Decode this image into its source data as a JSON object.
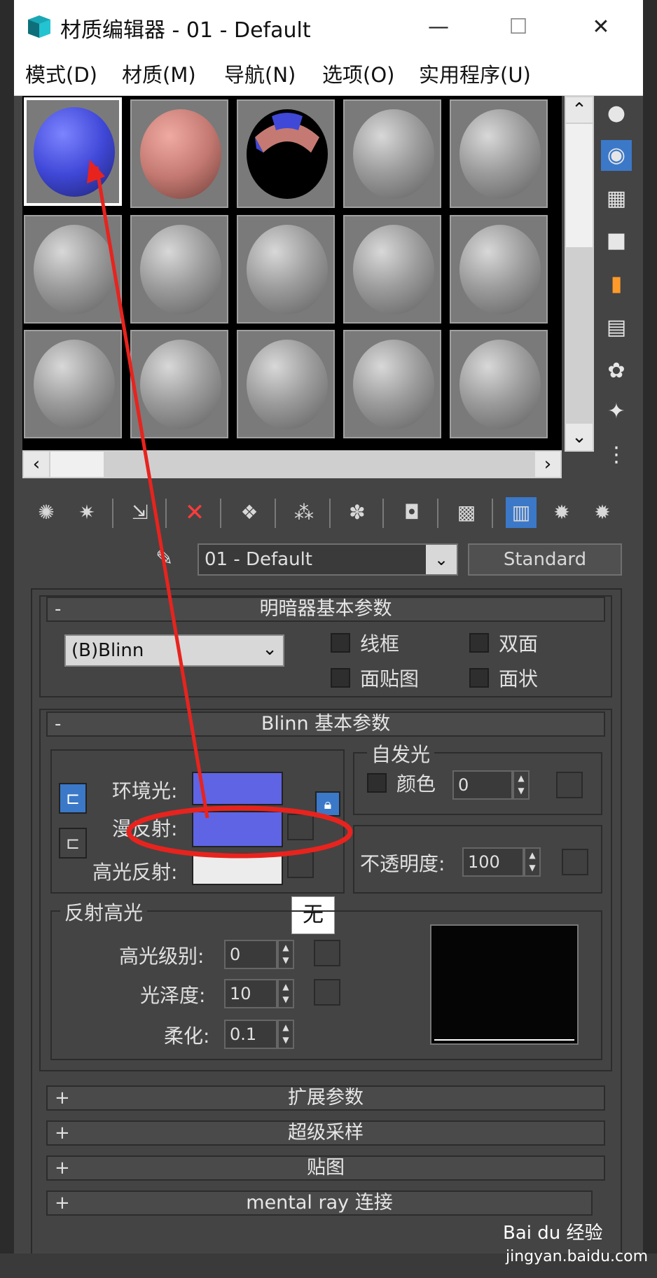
{
  "window": {
    "title": "材质编辑器 - 01 - Default",
    "minimize_glyph": "—",
    "maximize_glyph": "☐",
    "close_glyph": "✕"
  },
  "menu": [
    "模式(D)",
    "材质(M)",
    "导航(N)",
    "选项(O)",
    "实用程序(U)"
  ],
  "material": {
    "name": "01 - Default",
    "type": "Standard"
  },
  "shader_basic": {
    "title": "明暗器基本参数",
    "collapse": "-",
    "shader": "(B)Blinn",
    "options": [
      {
        "label": "线框",
        "checked": false
      },
      {
        "label": "双面",
        "checked": false
      },
      {
        "label": "面贴图",
        "checked": false
      },
      {
        "label": "面状",
        "checked": false
      }
    ]
  },
  "blinn_basic": {
    "title": "Blinn 基本参数",
    "collapse": "-",
    "ambient_label": "环境光:",
    "diffuse_label": "漫反射:",
    "specular_label": "高光反射:",
    "ambient_color": "#5f64e4",
    "diffuse_color": "#5f64e4",
    "specular_color": "#ececec",
    "self_illum": {
      "title": "自发光",
      "color_label": "颜色",
      "value": "0"
    },
    "opacity": {
      "label": "不透明度:",
      "value": "100"
    },
    "tooltip": "无",
    "specular_highlights": {
      "title": "反射高光",
      "level_label": "高光级别:",
      "level": "0",
      "gloss_label": "光泽度:",
      "gloss": "10",
      "soften_label": "柔化:",
      "soften": "0.1"
    }
  },
  "collapsed_rollouts": [
    {
      "sign": "+",
      "title": "扩展参数"
    },
    {
      "sign": "+",
      "title": "超级采样"
    },
    {
      "sign": "+",
      "title": "贴图"
    },
    {
      "sign": "+",
      "title": "mental ray 连接"
    }
  ],
  "slot_colors": {
    "slot1": "#4048d8",
    "slot2": "#c47a72",
    "default": "#9a9a9a"
  },
  "annotation_color": "#e8231e",
  "watermark": {
    "brand": "Bai du 经验",
    "url": "jingyan.baidu.com"
  }
}
